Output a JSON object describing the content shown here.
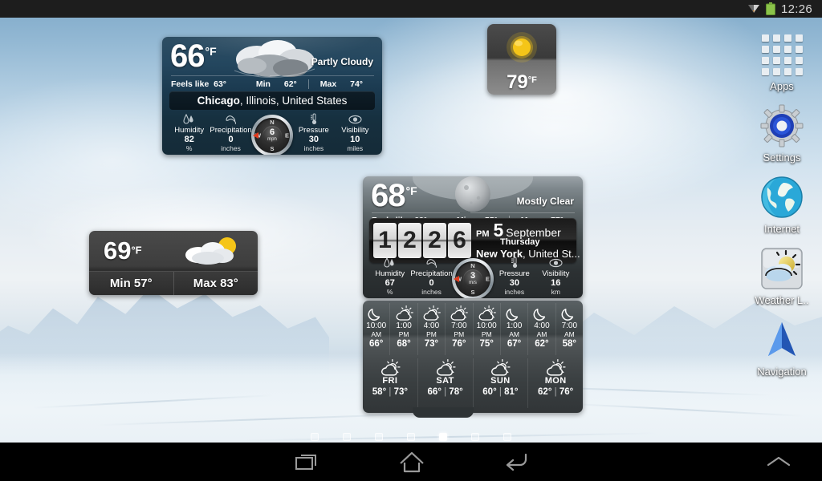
{
  "status_bar": {
    "time": "12:26",
    "icons": [
      "wifi-icon",
      "battery-icon"
    ]
  },
  "nav_bar": {
    "recent_label": "recent-apps",
    "home_label": "home",
    "back_label": "back",
    "expand_label": "expand-up"
  },
  "home": {
    "page_count": 7,
    "active_page": 5
  },
  "sidebar": {
    "items": [
      {
        "label": "Apps",
        "icon": "apps-grid-icon"
      },
      {
        "label": "Settings",
        "icon": "gear-icon"
      },
      {
        "label": "Internet",
        "icon": "globe-icon"
      },
      {
        "label": "Weather L..",
        "icon": "weather-sun-cloud-icon"
      },
      {
        "label": "Navigation",
        "icon": "navigation-arrow-icon"
      }
    ]
  },
  "widget_chicago": {
    "temperature": "66",
    "unit": "°F",
    "condition": "Partly Cloudy",
    "condition_icon": "cloud-icon",
    "feels_like_label": "Feels like",
    "feels_like_value": "63°",
    "min_label": "Min",
    "min_value": "62°",
    "max_label": "Max",
    "max_value": "74°",
    "location_city": "Chicago",
    "location_rest": ", Illinois, United States",
    "metrics": [
      {
        "icon": "humidity-drop-icon",
        "label": "Humidity",
        "value": "82",
        "unit": "%"
      },
      {
        "icon": "umbrella-icon",
        "label": "Precipitation",
        "value": "0",
        "unit": "inches"
      },
      {
        "icon": "thermometer-icon",
        "label": "Pressure",
        "value": "30",
        "unit": "inches"
      },
      {
        "icon": "eye-icon",
        "label": "Visibility",
        "value": "10",
        "unit": "miles"
      }
    ],
    "compass": {
      "speed": "6",
      "unit": "mph",
      "north": "N",
      "east": "E",
      "south": "S",
      "west": "W"
    }
  },
  "widget_small": {
    "temperature": "79",
    "unit": "°F",
    "icon": "sun-icon"
  },
  "widget_mini": {
    "temperature": "69",
    "unit": "°F",
    "icon": "sun-cloud-icon",
    "min_label": "Min 57°",
    "max_label": "Max 83°"
  },
  "widget_newyork": {
    "temperature": "68",
    "unit": "°F",
    "condition": "Mostly Clear",
    "condition_icon": "moon-icon",
    "feels_like_label": "Feels like",
    "feels_like_value": "63°",
    "min_label": "Min",
    "min_value": "55°",
    "max_label": "Max",
    "max_value": "77°",
    "clock": {
      "digits": [
        "1",
        "2",
        "2",
        "6"
      ],
      "ampm": "PM",
      "day_number": "5",
      "month": "September",
      "weekday": "Thursday",
      "location_city": "New York",
      "location_rest": ", United St..."
    },
    "metrics": [
      {
        "icon": "humidity-drop-icon",
        "label": "Humidity",
        "value": "67",
        "unit": "%"
      },
      {
        "icon": "umbrella-icon",
        "label": "Precipitation",
        "value": "0",
        "unit": "inches"
      },
      {
        "icon": "thermometer-icon",
        "label": "Pressure",
        "value": "30",
        "unit": "inches"
      },
      {
        "icon": "eye-icon",
        "label": "Visibility",
        "value": "16",
        "unit": "km"
      }
    ],
    "compass": {
      "speed": "3",
      "unit": "m/s",
      "north": "N",
      "east": "E",
      "south": "S",
      "west": "W"
    }
  },
  "forecast": {
    "hourly": [
      {
        "icon": "moon-icon",
        "time": "10:00",
        "period": "AM",
        "temp": "66°"
      },
      {
        "icon": "sun-cloud-icon",
        "time": "1:00",
        "period": "PM",
        "temp": "68°"
      },
      {
        "icon": "sun-cloud-icon",
        "time": "4:00",
        "period": "PM",
        "temp": "73°"
      },
      {
        "icon": "sun-cloud-icon",
        "time": "7:00",
        "period": "PM",
        "temp": "76°"
      },
      {
        "icon": "sun-cloud-icon",
        "time": "10:00",
        "period": "PM",
        "temp": "75°"
      },
      {
        "icon": "moon-icon",
        "time": "1:00",
        "period": "AM",
        "temp": "67°"
      },
      {
        "icon": "moon-icon",
        "time": "4:00",
        "period": "AM",
        "temp": "62°"
      },
      {
        "icon": "moon-icon",
        "time": "7:00",
        "period": "AM",
        "temp": "58°"
      }
    ],
    "daily": [
      {
        "icon": "sun-cloud-icon",
        "day": "FRI",
        "low": "58°",
        "high": "73°"
      },
      {
        "icon": "sun-cloud-icon",
        "day": "SAT",
        "low": "66°",
        "high": "78°"
      },
      {
        "icon": "sun-cloud-icon",
        "day": "SUN",
        "low": "60°",
        "high": "81°"
      },
      {
        "icon": "sun-cloud-icon",
        "day": "MON",
        "low": "62°",
        "high": "76°"
      }
    ]
  },
  "colors": {
    "status_bar_bg": "#1d1d1d",
    "nav_bar_bg": "#000000",
    "chicago_widget_bg": "#1b3a50",
    "newyork_widget_bg": "#3e4547",
    "accent_red": "#e03a1e",
    "sun_yellow": "#f5c518"
  }
}
